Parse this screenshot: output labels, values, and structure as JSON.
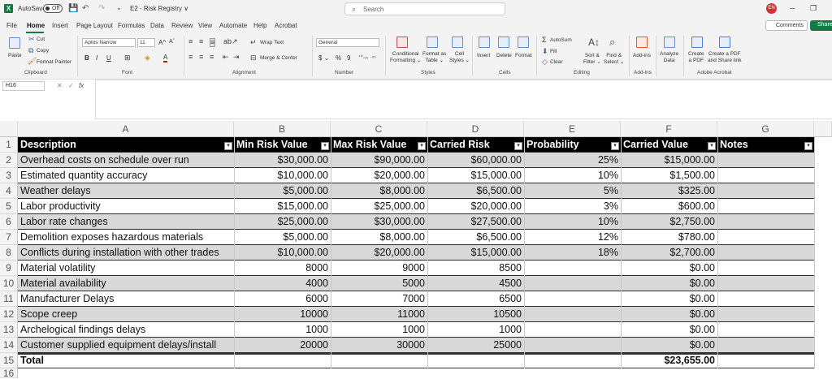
{
  "titlebar": {
    "autosave_label": "AutoSave",
    "autosave_state": "Off",
    "doc_title": "E2 - Risk Registry ∨",
    "search_placeholder": "Search",
    "user_initials": "EN"
  },
  "menu": {
    "items": [
      "File",
      "Home",
      "Insert",
      "Page Layout",
      "Formulas",
      "Data",
      "Review",
      "View",
      "Automate",
      "Help",
      "Acrobat"
    ],
    "active": "Home",
    "comments_label": "Comments",
    "share_label": "Share"
  },
  "ribbon": {
    "clipboard": {
      "paste": "Paste",
      "cut": "Cut",
      "copy": "Copy",
      "format_painter": "Format Painter",
      "label": "Clipboard"
    },
    "font": {
      "font_name": "Aptos Narrow",
      "font_size": "11",
      "label": "Font"
    },
    "alignment": {
      "wrap": "Wrap Text",
      "merge": "Merge & Center",
      "label": "Alignment"
    },
    "number": {
      "format": "General",
      "label": "Number"
    },
    "styles": {
      "conditional": "Conditional Formatting",
      "format_table": "Format as Table",
      "cell_styles": "Cell Styles",
      "label": "Styles"
    },
    "cells": {
      "insert": "Insert",
      "delete": "Delete",
      "format": "Format",
      "label": "Cells"
    },
    "editing": {
      "autosum": "AutoSum",
      "fill": "Fill",
      "clear": "Clear",
      "sort": "Sort & Filter",
      "find": "Find & Select",
      "label": "Editing"
    },
    "addins": {
      "addins": "Add-ins",
      "label": "Add-ins"
    },
    "analyze": {
      "analyze": "Analyze Data"
    },
    "acrobat": {
      "create_pdf": "Create a PDF",
      "create_share": "Create a PDF and Share link",
      "label": "Adobe Acrobat"
    }
  },
  "formula_bar": {
    "name_box": "H16",
    "fx": "fx",
    "value": ""
  },
  "columns": [
    "A",
    "B",
    "C",
    "D",
    "E",
    "F",
    "G"
  ],
  "table": {
    "headers": [
      "Description",
      "Min Risk Value",
      "Max Risk Value",
      "Carried Risk",
      "Probability",
      "Carried Value",
      "Notes"
    ],
    "rows": [
      {
        "n": "2",
        "desc": "Overhead costs on schedule over run",
        "min": "$30,000.00",
        "max": "$90,000.00",
        "carried": "$60,000.00",
        "prob": "25%",
        "value": "$15,000.00"
      },
      {
        "n": "3",
        "desc": "Estimated quantity accuracy",
        "min": "$10,000.00",
        "max": "$20,000.00",
        "carried": "$15,000.00",
        "prob": "10%",
        "value": "$1,500.00"
      },
      {
        "n": "4",
        "desc": "Weather delays",
        "min": "$5,000.00",
        "max": "$8,000.00",
        "carried": "$6,500.00",
        "prob": "5%",
        "value": "$325.00"
      },
      {
        "n": "5",
        "desc": "Labor productivity",
        "min": "$15,000.00",
        "max": "$25,000.00",
        "carried": "$20,000.00",
        "prob": "3%",
        "value": "$600.00"
      },
      {
        "n": "6",
        "desc": "Labor rate changes",
        "min": "$25,000.00",
        "max": "$30,000.00",
        "carried": "$27,500.00",
        "prob": "10%",
        "value": "$2,750.00"
      },
      {
        "n": "7",
        "desc": "Demolition exposes hazardous materials",
        "min": "$5,000.00",
        "max": "$8,000.00",
        "carried": "$6,500.00",
        "prob": "12%",
        "value": "$780.00"
      },
      {
        "n": "8",
        "desc": "Conflicts during installation with other trades",
        "min": "$10,000.00",
        "max": "$20,000.00",
        "carried": "$15,000.00",
        "prob": "18%",
        "value": "$2,700.00"
      },
      {
        "n": "9",
        "desc": "Material volatility",
        "min": "8000",
        "max": "9000",
        "carried": "8500",
        "prob": "",
        "value": "$0.00"
      },
      {
        "n": "10",
        "desc": "Material availability",
        "min": "4000",
        "max": "5000",
        "carried": "4500",
        "prob": "",
        "value": "$0.00"
      },
      {
        "n": "11",
        "desc": "Manufacturer Delays",
        "min": "6000",
        "max": "7000",
        "carried": "6500",
        "prob": "",
        "value": "$0.00"
      },
      {
        "n": "12",
        "desc": "Scope creep",
        "min": "10000",
        "max": "11000",
        "carried": "10500",
        "prob": "",
        "value": "$0.00"
      },
      {
        "n": "13",
        "desc": "Archelogical findings delays",
        "min": "1000",
        "max": "1000",
        "carried": "1000",
        "prob": "",
        "value": "$0.00"
      },
      {
        "n": "14",
        "desc": "Customer supplied equipment delays/install",
        "min": "20000",
        "max": "30000",
        "carried": "25000",
        "prob": "",
        "value": "$0.00"
      }
    ],
    "total": {
      "n": "15",
      "label": "Total",
      "value": "$23,655.00"
    },
    "next_row": "16"
  }
}
